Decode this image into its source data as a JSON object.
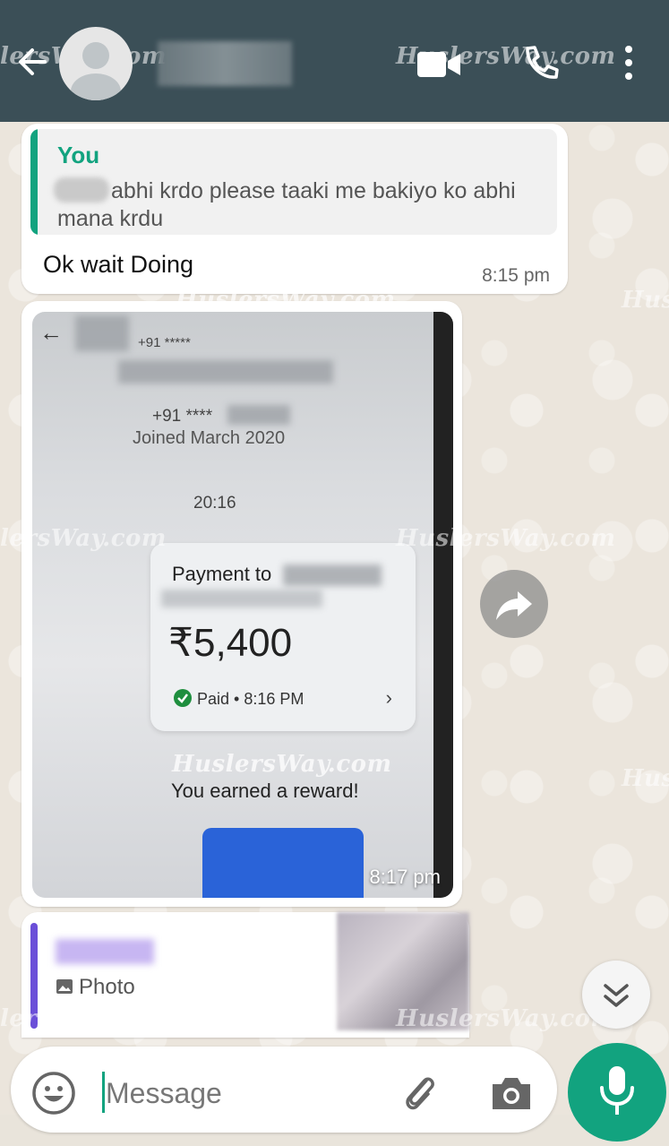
{
  "header": {
    "watermark_left": "lersWay.com",
    "watermark_right": "HuslersWay.com",
    "icons": [
      "back-arrow-icon",
      "avatar-icon",
      "video-icon",
      "phone-icon",
      "more-vert-icon"
    ]
  },
  "watermarks": {
    "mid_left": "lersWay.com",
    "mid_right": "HuslersWay.com",
    "photo_top": "HuslersWay.com",
    "photo_mid": "HuslersWay.com",
    "edge_right_1": "Hus",
    "edge_right_2": "Hus",
    "bottom_left": "lersWay.com",
    "bottom_right": "HuslersWay.com"
  },
  "messages": {
    "m1": {
      "quote_author": "You",
      "quote_text": "abhi krdo please taaki me bakiyo ko abhi mana krdu",
      "text": "Ok wait Doing",
      "time": "8:15 pm"
    },
    "m2": {
      "photo": {
        "back_glyph": "←",
        "phone_top": "+91 *****",
        "phone": "+91 ****",
        "joined": "Joined March 2020",
        "time": "20:16",
        "payment_to": "Payment to",
        "amount": "₹5,400",
        "status": "Paid • 8:16 PM",
        "chevron": "›",
        "reward": "You earned a reward!"
      },
      "time": "8:17 pm"
    },
    "m3": {
      "reply_label": "Photo"
    }
  },
  "input": {
    "placeholder": "Message"
  },
  "colors": {
    "header": "#3b4f57",
    "accent": "#12a37f",
    "reply_accent": "#6b4fd8"
  }
}
